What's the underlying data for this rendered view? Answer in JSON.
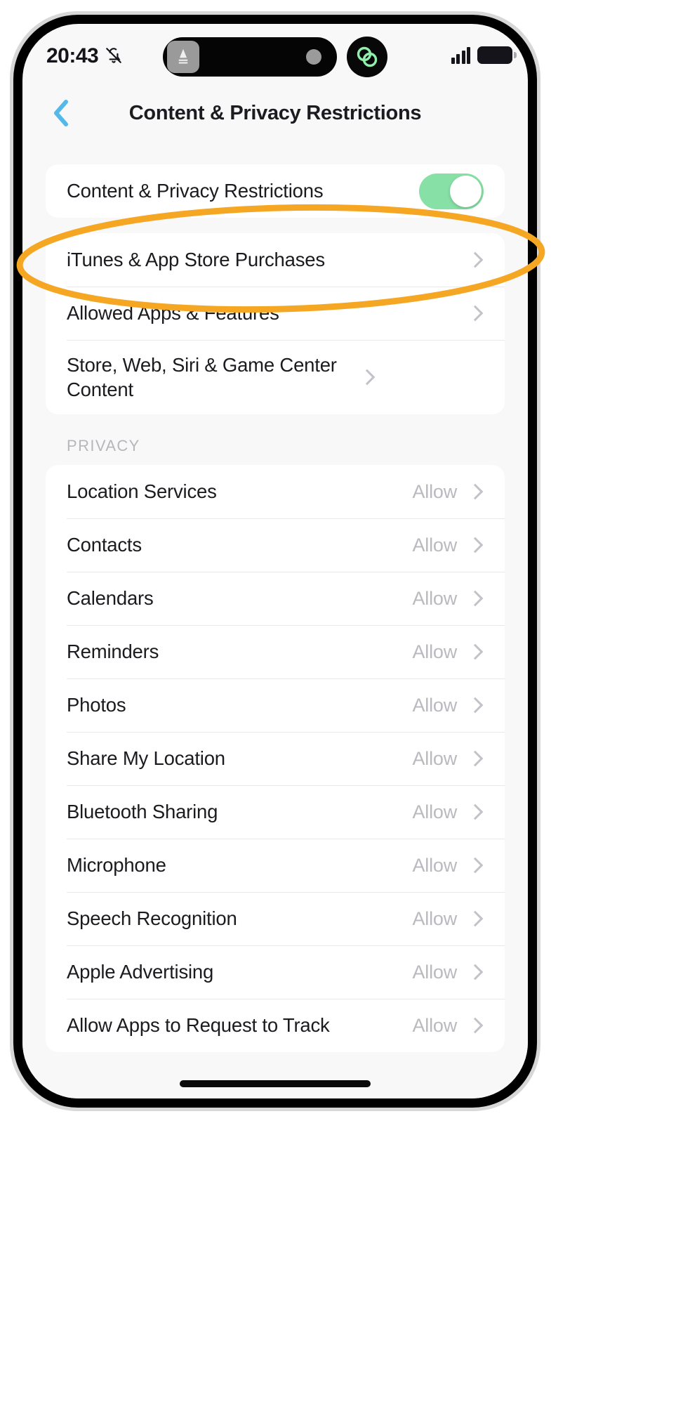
{
  "status_bar": {
    "time": "20:43",
    "silent_icon": "bell-slash-icon",
    "dynamic_island": {
      "app_icon": "app-icon",
      "activity_dot": "recording-dot",
      "bubble_icon": "linked-rings-icon"
    },
    "signal_icon": "cellular-signal-icon",
    "battery_icon": "battery-full-icon"
  },
  "nav": {
    "back_icon": "back-chevron-icon",
    "title": "Content & Privacy Restrictions"
  },
  "annotation": {
    "type": "ellipse-highlight",
    "color": "#F5A623",
    "target": "iTunes & App Store Purchases"
  },
  "main_card": {
    "toggle_row": {
      "label": "Content & Privacy Restrictions",
      "toggle_state": "on",
      "toggle_color": "#87E0A6"
    },
    "rows": [
      {
        "label": "iTunes & App Store Purchases",
        "chevron": "chevron-right-icon"
      },
      {
        "label": "Allowed Apps & Features",
        "chevron": "chevron-right-icon"
      },
      {
        "label": "Store, Web, Siri & Game Center Content",
        "chevron": "chevron-right-icon",
        "two_line": true
      }
    ]
  },
  "privacy_section": {
    "header": "PRIVACY",
    "rows": [
      {
        "label": "Location Services",
        "value": "Allow"
      },
      {
        "label": "Contacts",
        "value": "Allow"
      },
      {
        "label": "Calendars",
        "value": "Allow"
      },
      {
        "label": "Reminders",
        "value": "Allow"
      },
      {
        "label": "Photos",
        "value": "Allow"
      },
      {
        "label": "Share My Location",
        "value": "Allow"
      },
      {
        "label": "Bluetooth Sharing",
        "value": "Allow"
      },
      {
        "label": "Microphone",
        "value": "Allow"
      },
      {
        "label": "Speech Recognition",
        "value": "Allow"
      },
      {
        "label": "Apple Advertising",
        "value": "Allow"
      },
      {
        "label": "Allow Apps to Request to Track",
        "value": "Allow"
      }
    ]
  }
}
